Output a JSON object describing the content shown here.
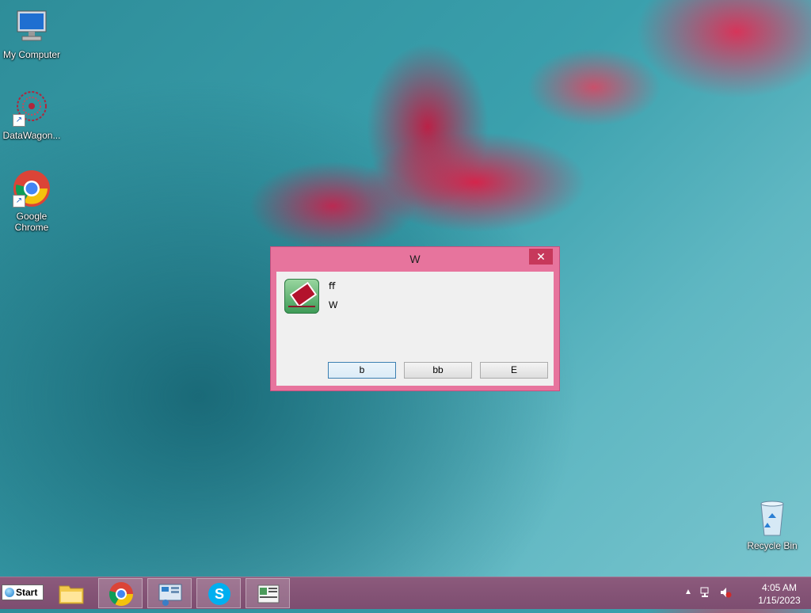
{
  "desktop": {
    "icons": [
      {
        "label": "My Computer"
      },
      {
        "label": "DataWagon..."
      },
      {
        "label": "Google Chrome"
      },
      {
        "label": "Recycle Bin"
      }
    ]
  },
  "dialog": {
    "title": "W",
    "close_label": "✕",
    "line1": "ﬀ",
    "line2": "W",
    "buttons": [
      {
        "label": "b"
      },
      {
        "label": "bb"
      },
      {
        "label": "E"
      }
    ]
  },
  "taskbar": {
    "start_label": "Start",
    "items": [
      "file-explorer-icon",
      "chrome-icon",
      "control-panel-icon",
      "skype-icon",
      "app-window-icon"
    ],
    "tray": {
      "time": "4:05 AM",
      "date": "1/15/2023"
    }
  },
  "colors": {
    "dialog_frame": "#e7749d",
    "taskbar": "#8c5a7c"
  }
}
